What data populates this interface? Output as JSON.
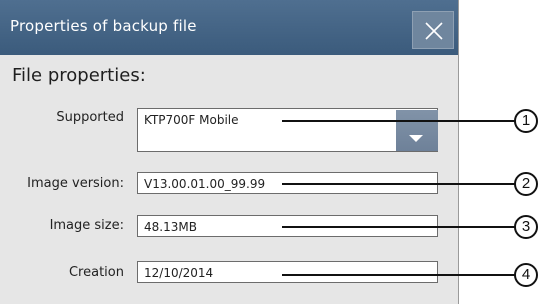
{
  "window": {
    "title": "Properties of backup file",
    "close_icon": "close-icon"
  },
  "section_title": "File properties:",
  "fields": {
    "supported": {
      "label": "Supported",
      "value": "KTP700F Mobile"
    },
    "image_version": {
      "label": "Image version:",
      "value": "V13.00.01.00_99.99"
    },
    "image_size": {
      "label": "Image size:",
      "value": "48.13MB"
    },
    "creation": {
      "label": "Creation",
      "value": "12/10/2014"
    }
  },
  "callouts": [
    "1",
    "2",
    "3",
    "4"
  ]
}
